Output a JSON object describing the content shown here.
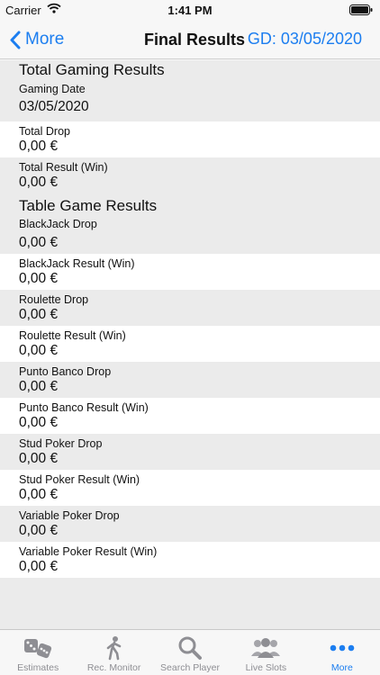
{
  "status_bar": {
    "carrier": "Carrier",
    "time": "1:41 PM"
  },
  "nav": {
    "back_label": "More",
    "title": "Final Results",
    "gaming_day": "GD: 03/05/2020"
  },
  "sections": [
    {
      "title": "Total Gaming Results",
      "first_item": {
        "label": "Gaming Date",
        "value": "03/05/2020"
      },
      "items": [
        {
          "label": "Total Drop",
          "value": "0,00 €"
        },
        {
          "label": "Total Result (Win)",
          "value": "0,00 €"
        }
      ]
    },
    {
      "title": "Table Game Results",
      "first_item": {
        "label": "BlackJack Drop",
        "value": "0,00 €"
      },
      "items": [
        {
          "label": "BlackJack Result (Win)",
          "value": "0,00 €"
        },
        {
          "label": "Roulette Drop",
          "value": "0,00 €"
        },
        {
          "label": "Roulette Result (Win)",
          "value": "0,00 €"
        },
        {
          "label": "Punto Banco Drop",
          "value": "0,00 €"
        },
        {
          "label": "Punto Banco Result (Win)",
          "value": "0,00 €"
        },
        {
          "label": "Stud Poker Drop",
          "value": "0,00 €"
        },
        {
          "label": "Stud Poker Result (Win)",
          "value": "0,00 €"
        },
        {
          "label": "Variable Poker Drop",
          "value": "0,00 €"
        },
        {
          "label": "Variable Poker Result (Win)",
          "value": "0,00 €"
        }
      ]
    }
  ],
  "tabs": [
    {
      "label": "Estimates",
      "icon": "dice-icon"
    },
    {
      "label": "Rec. Monitor",
      "icon": "walking-person-icon"
    },
    {
      "label": "Search Player",
      "icon": "magnifier-icon"
    },
    {
      "label": "Live Slots",
      "icon": "people-group-icon"
    },
    {
      "label": "More",
      "icon": "more-dots-icon"
    }
  ],
  "colors": {
    "accent": "#1c7ef0",
    "row_alt": "#ebebeb",
    "row": "#ffffff",
    "tab_inactive": "#8e8e93"
  }
}
